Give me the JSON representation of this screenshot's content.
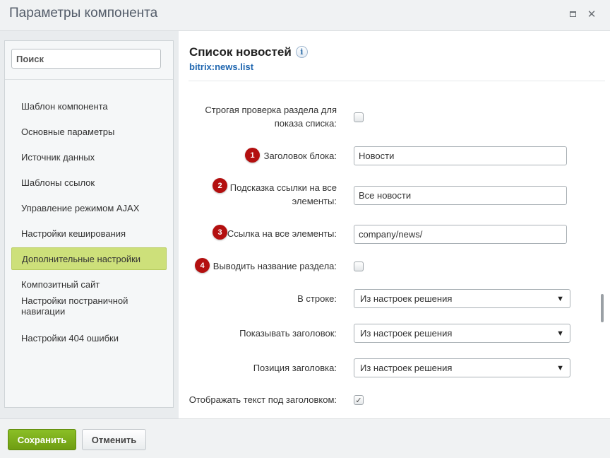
{
  "window": {
    "title": "Параметры компонента"
  },
  "sidebar": {
    "search_placeholder": "Поиск",
    "items": [
      {
        "label": "Шаблон компонента",
        "active": false
      },
      {
        "label": "Основные параметры",
        "active": false
      },
      {
        "label": "Источник данных",
        "active": false
      },
      {
        "label": "Шаблоны ссылок",
        "active": false
      },
      {
        "label": "Управление режимом AJAX",
        "active": false
      },
      {
        "label": "Настройки кеширования",
        "active": false
      },
      {
        "label": "Дополнительные настройки",
        "active": true
      },
      {
        "label": "Композитный сайт",
        "active": false
      },
      {
        "label": "Настройки постраничной навигации",
        "active": false
      },
      {
        "label": "Настройки 404 ошибки",
        "active": false
      }
    ]
  },
  "component": {
    "title": "Список новостей",
    "info_icon": "i",
    "code": "bitrix:news.list"
  },
  "fields": {
    "strict_check": {
      "label": "Строгая проверка раздела для показа списка:",
      "checked": false
    },
    "block_title": {
      "badge": "1",
      "label": "Заголовок блока:",
      "value": "Новости"
    },
    "all_link_hint": {
      "badge": "2",
      "label": "Подсказка ссылки на все элементы:",
      "value": "Все новости"
    },
    "all_link": {
      "badge": "3",
      "label": "Ссылка на все элементы:",
      "value": "company/news/"
    },
    "show_section_name": {
      "badge": "4",
      "label": "Выводить название раздела:",
      "checked": false
    },
    "per_row": {
      "label": "В строке:",
      "value": "Из настроек решения"
    },
    "show_title": {
      "label": "Показывать заголовок:",
      "value": "Из настроек решения"
    },
    "title_position": {
      "label": "Позиция заголовка:",
      "value": "Из настроек решения"
    },
    "show_subtitle_text": {
      "label": "Отображать текст под заголовком:",
      "checked": true
    }
  },
  "footer": {
    "save_label": "Сохранить",
    "cancel_label": "Отменить"
  },
  "colors": {
    "badge": "#b30f0f",
    "active_item": "#cde07a",
    "save_button": "#7aac1a",
    "link": "#2067b0"
  }
}
